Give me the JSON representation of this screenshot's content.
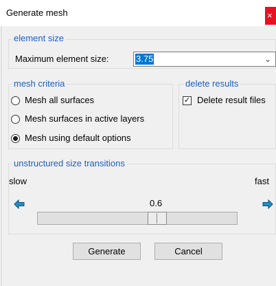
{
  "window": {
    "title": "Generate mesh",
    "close_glyph": "×"
  },
  "element_size": {
    "legend": "element size",
    "max_label": "Maximum element size:",
    "max_value": "3.75"
  },
  "mesh_criteria": {
    "legend": "mesh criteria",
    "options": [
      {
        "label": "Mesh all surfaces",
        "selected": false
      },
      {
        "label": "Mesh surfaces in active layers",
        "selected": false
      },
      {
        "label": "Mesh using default options",
        "selected": true
      }
    ]
  },
  "delete_results": {
    "legend": "delete results",
    "checkbox_label": "Delete result files",
    "checked": true
  },
  "transitions": {
    "legend": "unstructured size transitions",
    "slow_label": "slow",
    "fast_label": "fast",
    "value": "0.6",
    "fraction": 0.6
  },
  "buttons": {
    "generate": "Generate",
    "cancel": "Cancel"
  },
  "colors": {
    "legend": "#1c5fc4",
    "arrow_fill": "#1e90c8",
    "selection": "#0078d7"
  },
  "icons": {
    "left_arrow": "arrow-left-icon",
    "right_arrow": "arrow-right-icon"
  }
}
